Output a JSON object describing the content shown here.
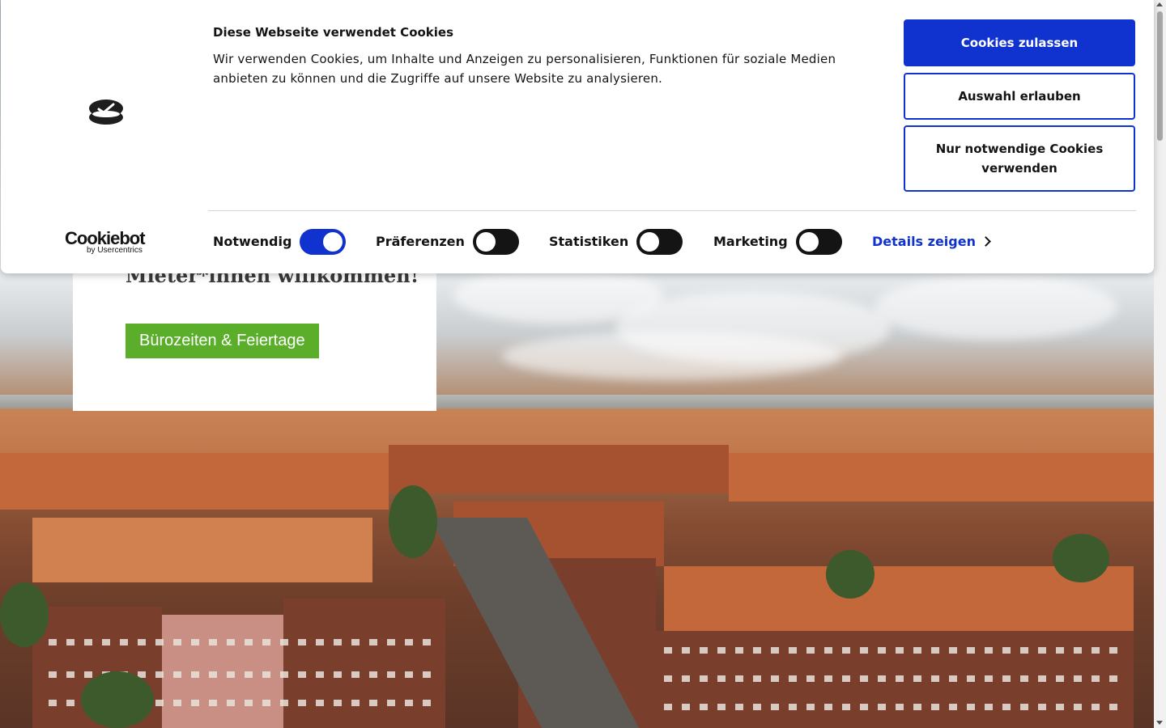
{
  "hero": {
    "heading_partial": "Mieter*innen willkommen!",
    "button_label": "Bürozeiten & Feiertage"
  },
  "cookie_banner": {
    "title": "Diese Webseite verwendet Cookies",
    "description": "Wir verwenden Cookies, um Inhalte und Anzeigen zu personalisieren, Funktionen für soziale Medien anbieten zu können und die Zugriffe auf unsere Website zu analysieren.",
    "buttons": {
      "allow_all": "Cookies zulassen",
      "allow_selection": "Auswahl erlauben",
      "necessary_only": "Nur notwendige Cookies verwenden"
    },
    "brand": {
      "name": "Cookiebot",
      "by": "by Usercentrics"
    },
    "toggles": [
      {
        "label": "Notwendig",
        "checked": true
      },
      {
        "label": "Präferenzen",
        "checked": false
      },
      {
        "label": "Statistiken",
        "checked": false
      },
      {
        "label": "Marketing",
        "checked": false
      }
    ],
    "details_link": "Details zeigen"
  },
  "colors": {
    "accent_blue": "#1032cf",
    "hero_button_green": "#5aae2a"
  }
}
